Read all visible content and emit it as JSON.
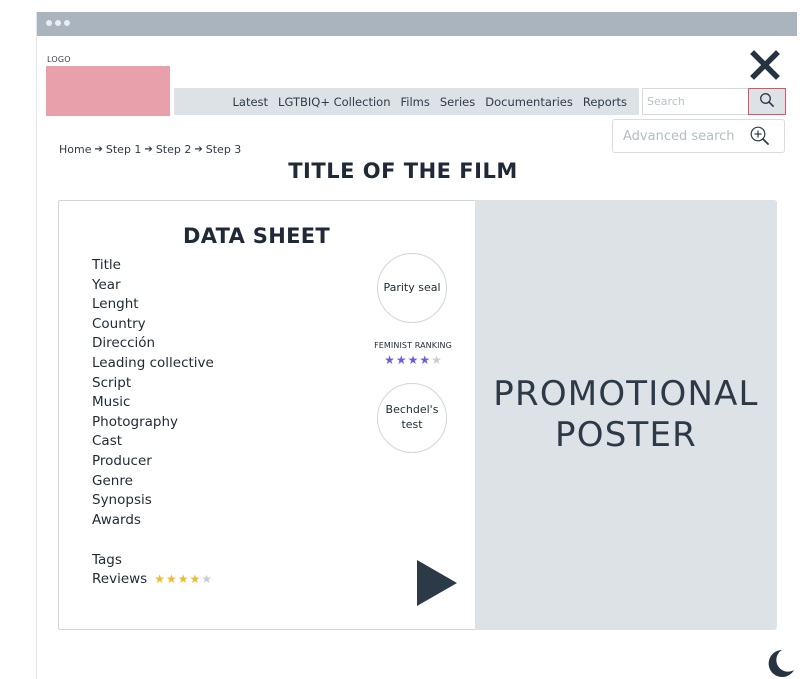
{
  "header": {
    "logo_label": "LOGO",
    "close_icon": "close-x-icon"
  },
  "nav": {
    "items": [
      "Latest",
      "LGTBIQ+ Collection",
      "Films",
      "Series",
      "Documentaries",
      "Reports"
    ]
  },
  "search": {
    "placeholder": "Search",
    "icon": "search-icon",
    "advanced_label": "Advanced search",
    "advanced_icon": "zoom-plus-icon"
  },
  "breadcrumb": {
    "items": [
      "Home",
      "Step 1",
      "Step 2",
      "Step 3"
    ]
  },
  "page": {
    "title": "TITLE OF THE FILM"
  },
  "data_sheet": {
    "title": "DATA SHEET",
    "fields": [
      "Title",
      "Year",
      "Lenght",
      "Country",
      "Dirección",
      "Leading collective",
      "Script",
      "Music",
      "Photography",
      "Cast",
      "Producer",
      "Genre",
      "Synopsis",
      "Awards"
    ],
    "tags_label": "Tags",
    "reviews_label": "Reviews",
    "reviews_rating": 4,
    "reviews_max": 5
  },
  "badges": {
    "parity_seal": "Parity seal",
    "feminist_ranking_label": "FEMINIST RANKING",
    "feminist_ranking_rating": 4,
    "feminist_ranking_max": 5,
    "bechdel_line1": "Bechdel's",
    "bechdel_line2": "test"
  },
  "poster": {
    "line1": "PROMOTIONAL",
    "line2": "POSTER"
  },
  "colors": {
    "logo_placeholder": "#e8a1ab",
    "search_highlight": "#e0505f",
    "panel_gray": "#dde2e7",
    "text_dark": "#2c3a48",
    "star_gold": "#f1b92c",
    "star_purple": "#6a5fd6",
    "star_empty": "#c9ced4"
  },
  "icons": {
    "play": "play-icon",
    "dark_mode": "moon-icon"
  }
}
